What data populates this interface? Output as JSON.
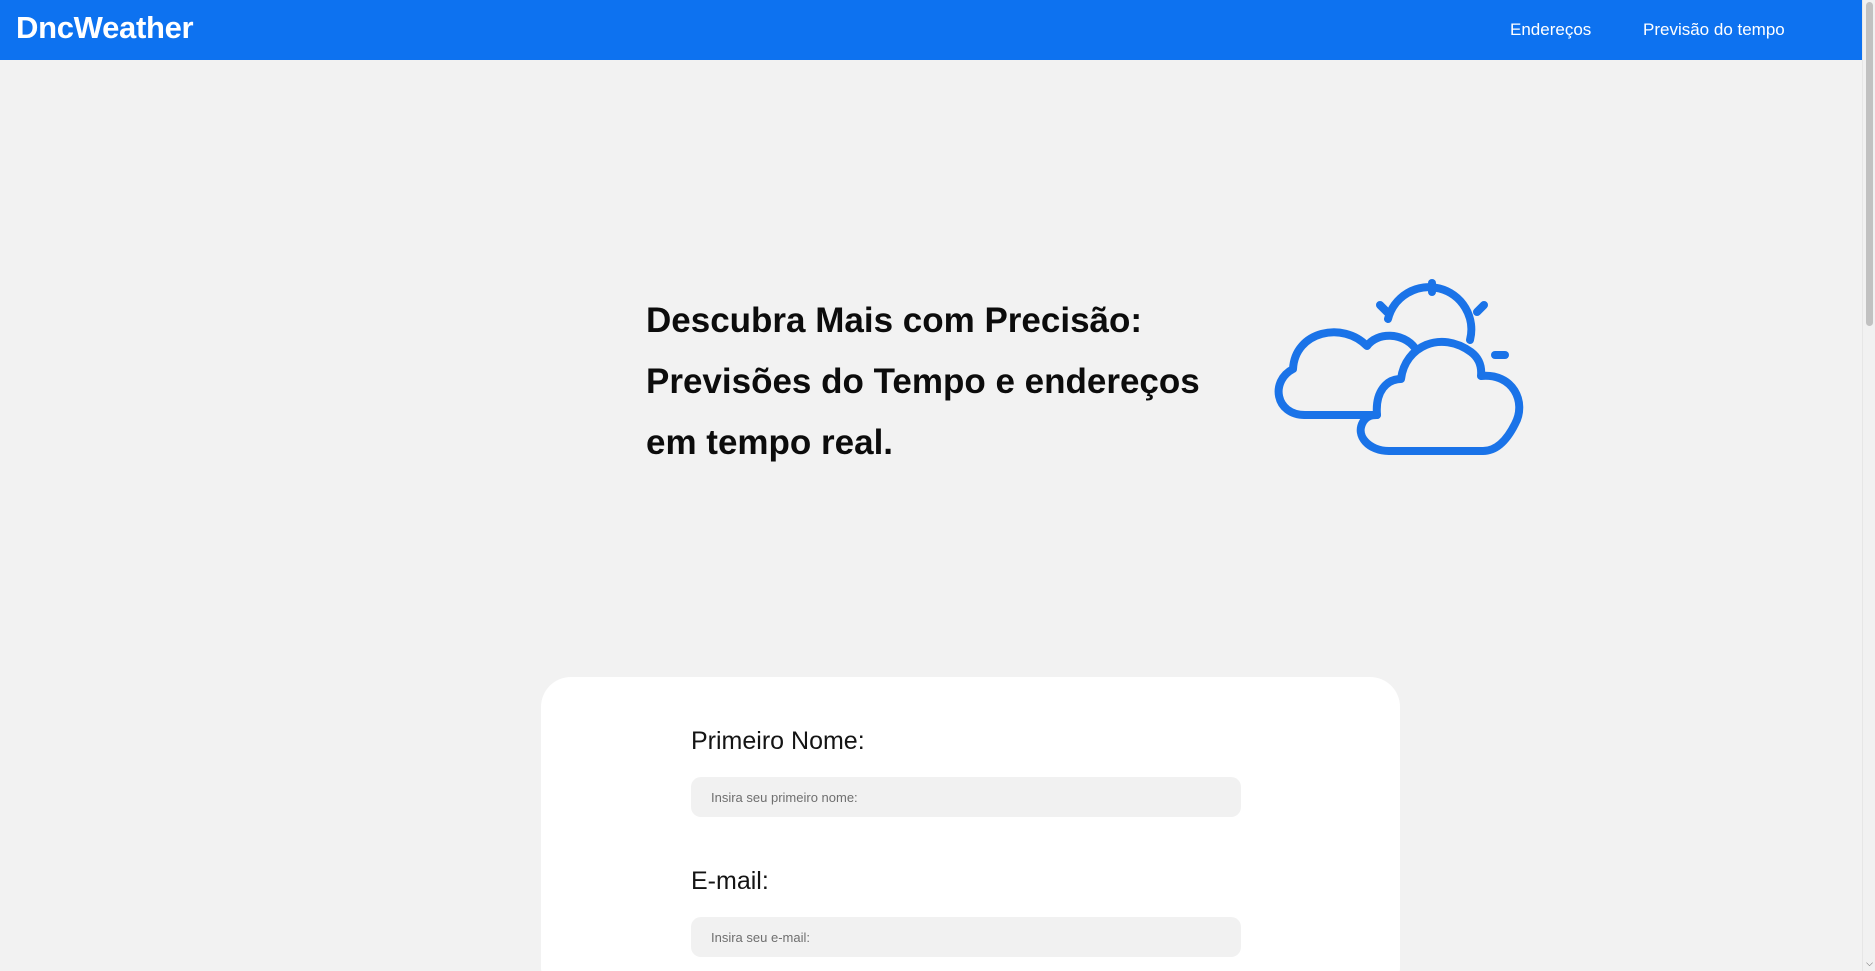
{
  "header": {
    "brand": "DncWeather",
    "nav": [
      {
        "label": "Endereços"
      },
      {
        "label": "Previsão do tempo"
      }
    ]
  },
  "hero": {
    "title_lines": [
      "Descubra Mais com Precisão:",
      "Previsões do Tempo e endereços",
      "em tempo real."
    ],
    "illustration_icon": "partly-cloudy-icon"
  },
  "form": {
    "first_name": {
      "label": "Primeiro Nome:",
      "placeholder": "Insira seu primeiro nome:",
      "value": ""
    },
    "email": {
      "label": "E-mail:",
      "placeholder": "Insira seu e-mail:",
      "value": ""
    }
  },
  "colors": {
    "brand_blue": "#0d72f0",
    "icon_blue": "#1a73e8",
    "page_background": "#f2f2f2",
    "card_background": "#ffffff"
  }
}
